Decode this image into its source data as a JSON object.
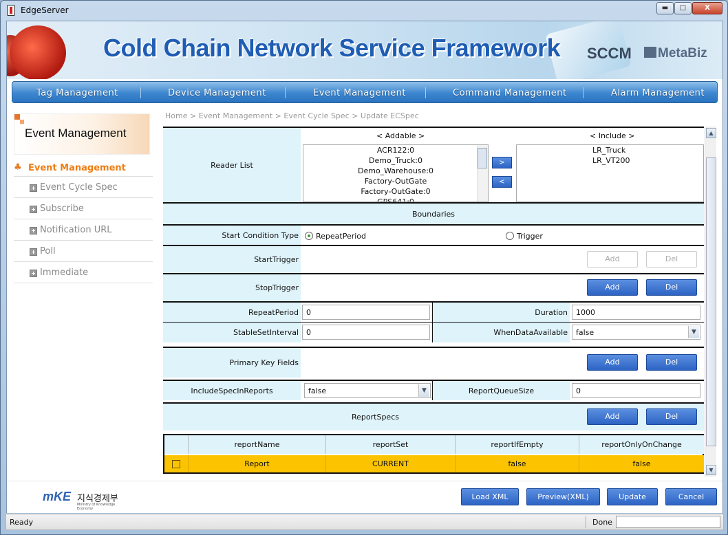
{
  "window": {
    "title": "EdgeServer",
    "minimize": "▬",
    "maximize": "□",
    "close": "X"
  },
  "banner": {
    "title": "Cold Chain Network Service Framework",
    "brand1": "SCCM",
    "brand2": "MetaBiz"
  },
  "nav": [
    "Tag Management",
    "Device Management",
    "Event Management",
    "Command Management",
    "Alarm Management"
  ],
  "sidebar": {
    "header": "Event Management",
    "active": "Event Management",
    "items": [
      "Event Cycle Spec",
      "Subscribe",
      "Notification URL",
      "Poll",
      "Immediate"
    ]
  },
  "breadcrumb": "Home > Event Management  >  Event Cycle Spec  >  Update ECSpec",
  "reader_list": {
    "label": "Reader List",
    "addable_header": "< Addable >",
    "include_header": "< Include >",
    "addable": [
      "ACR122:0",
      "Demo_Truck:0",
      "Demo_Warehouse:0",
      "Factory-OutGate",
      "Factory-OutGate:0",
      "GPS641:0"
    ],
    "include": [
      "LR_Truck",
      "LR_VT200"
    ],
    "add_arrow": ">",
    "remove_arrow": "<"
  },
  "boundaries": {
    "section_title": "Boundaries",
    "start_condition_label": "Start Condition Type",
    "radio_repeat": "RepeatPeriod",
    "radio_trigger": "Trigger",
    "start_trigger_label": "StartTrigger",
    "stop_trigger_label": "StopTrigger",
    "repeat_period_label": "RepeatPeriod",
    "repeat_period_value": "0",
    "duration_label": "Duration",
    "duration_value": "1000",
    "stable_set_label": "StableSetInterval",
    "stable_set_value": "0",
    "when_data_label": "WhenDataAvailable",
    "when_data_value": "false"
  },
  "primary_key_label": "Primary Key Fields",
  "include_spec_label": "IncludeSpecInReports",
  "include_spec_value": "false",
  "report_queue_label": "ReportQueueSize",
  "report_queue_value": "0",
  "report_specs_label": "ReportSpecs",
  "buttons": {
    "add": "Add",
    "del": "Del"
  },
  "table": {
    "headers": [
      "reportName",
      "reportSet",
      "reportIfEmpty",
      "reportOnlyOnChange"
    ],
    "rows": [
      {
        "reportName": "Report",
        "reportSet": "CURRENT",
        "reportIfEmpty": "false",
        "reportOnlyOnChange": "false"
      }
    ]
  },
  "footer": {
    "logo_mark": "mKE",
    "logo_text": "지식경제부",
    "logo_sub": "Ministry of Knowledge Economy",
    "load_xml": "Load XML",
    "preview_xml": "Preview(XML)",
    "update": "Update",
    "cancel": "Cancel"
  },
  "status": {
    "left": "Ready",
    "right": "Done"
  },
  "colors": {
    "nav_blue": "#3d86cf",
    "label_bg": "#dff3fa",
    "row_selected": "#fcc400",
    "active_orange": "#ee7d12"
  }
}
